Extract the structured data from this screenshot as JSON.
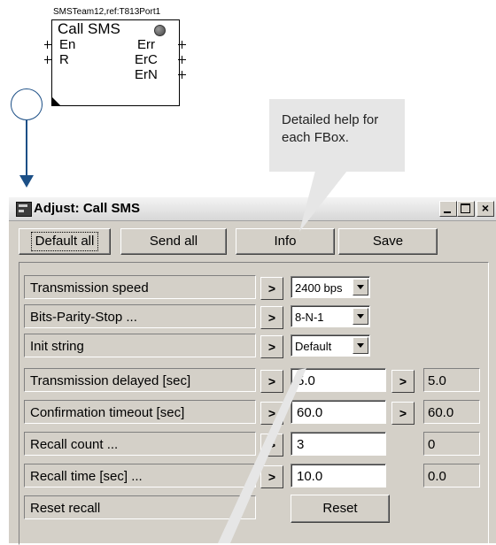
{
  "fbox": {
    "ref": "SMSTeam12,ref:T813Port1",
    "title": "Call SMS",
    "inputs": [
      "En",
      "R"
    ],
    "outputs": [
      "Err",
      "ErC",
      "ErN"
    ]
  },
  "callout": {
    "line1": "Detailed help for",
    "line2": "each FBox."
  },
  "dialog": {
    "title": "Adjust: Call SMS",
    "window_buttons": {
      "minimize": "_",
      "maximize": "□",
      "close": "×"
    },
    "toolbar": {
      "default_all": "Default all",
      "send_all": "Send all",
      "info": "Info",
      "save": "Save"
    },
    "params": [
      {
        "label": "Transmission speed",
        "arrow": ">",
        "value": "2400 bps"
      },
      {
        "label": "Bits-Parity-Stop ...",
        "arrow": ">",
        "value": "8-N-1"
      },
      {
        "label": "Init string",
        "arrow": ">",
        "value": "Default"
      },
      {
        "label": "Transmission delayed [sec]",
        "arrow": ">",
        "value": "5.0",
        "arrow2": ">",
        "readback": "5.0"
      },
      {
        "label": "Confirmation timeout [sec]",
        "arrow": ">",
        "value": "60.0",
        "arrow2": ">",
        "readback": "60.0"
      },
      {
        "label": "Recall count ...",
        "arrow": ">",
        "value": "3",
        "readback": "0"
      },
      {
        "label": "Recall time [sec] ...",
        "arrow": ">",
        "value": "10.0",
        "readback": "0.0"
      },
      {
        "label": "Reset recall",
        "button": "Reset"
      }
    ]
  },
  "colors": {
    "connector": "#1c4f86",
    "callout_bg": "#e6e6e6",
    "dialog_bg": "#d4d0c8"
  }
}
